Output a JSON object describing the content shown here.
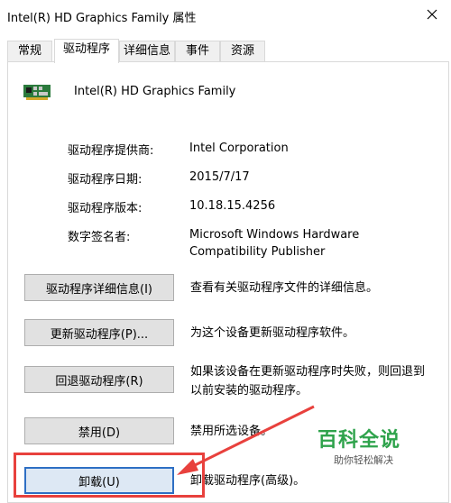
{
  "window": {
    "title": "Intel(R) HD Graphics Family 属性"
  },
  "tabs": [
    {
      "label": "常规"
    },
    {
      "label": "驱动程序"
    },
    {
      "label": "详细信息"
    },
    {
      "label": "事件"
    },
    {
      "label": "资源"
    }
  ],
  "device": {
    "name": "Intel(R) HD Graphics Family",
    "icon": "display-adapter-icon"
  },
  "driver_info": [
    {
      "label": "驱动程序提供商:",
      "value": "Intel Corporation"
    },
    {
      "label": "驱动程序日期:",
      "value": "2015/7/17"
    },
    {
      "label": "驱动程序版本:",
      "value": "10.18.15.4256"
    },
    {
      "label": "数字签名者:",
      "value": "Microsoft Windows Hardware Compatibility Publisher"
    }
  ],
  "actions": [
    {
      "button": "驱动程序详细信息(I)",
      "description": "查看有关驱动程序文件的详细信息。"
    },
    {
      "button": "更新驱动程序(P)...",
      "description": "为这个设备更新驱动程序软件。"
    },
    {
      "button": "回退驱动程序(R)",
      "description": "如果该设备在更新驱动程序时失败，则回退到以前安装的驱动程序。"
    },
    {
      "button": "禁用(D)",
      "description": "禁用所选设备。"
    },
    {
      "button": "卸载(U)",
      "description": "卸载驱动程序(高级)。"
    }
  ],
  "watermark": {
    "main": "百科全说",
    "sub": "助你轻松解决"
  },
  "colors": {
    "highlight": "#e8413d",
    "watermark": "#2fa34c",
    "focus": "#2e6fc4"
  }
}
